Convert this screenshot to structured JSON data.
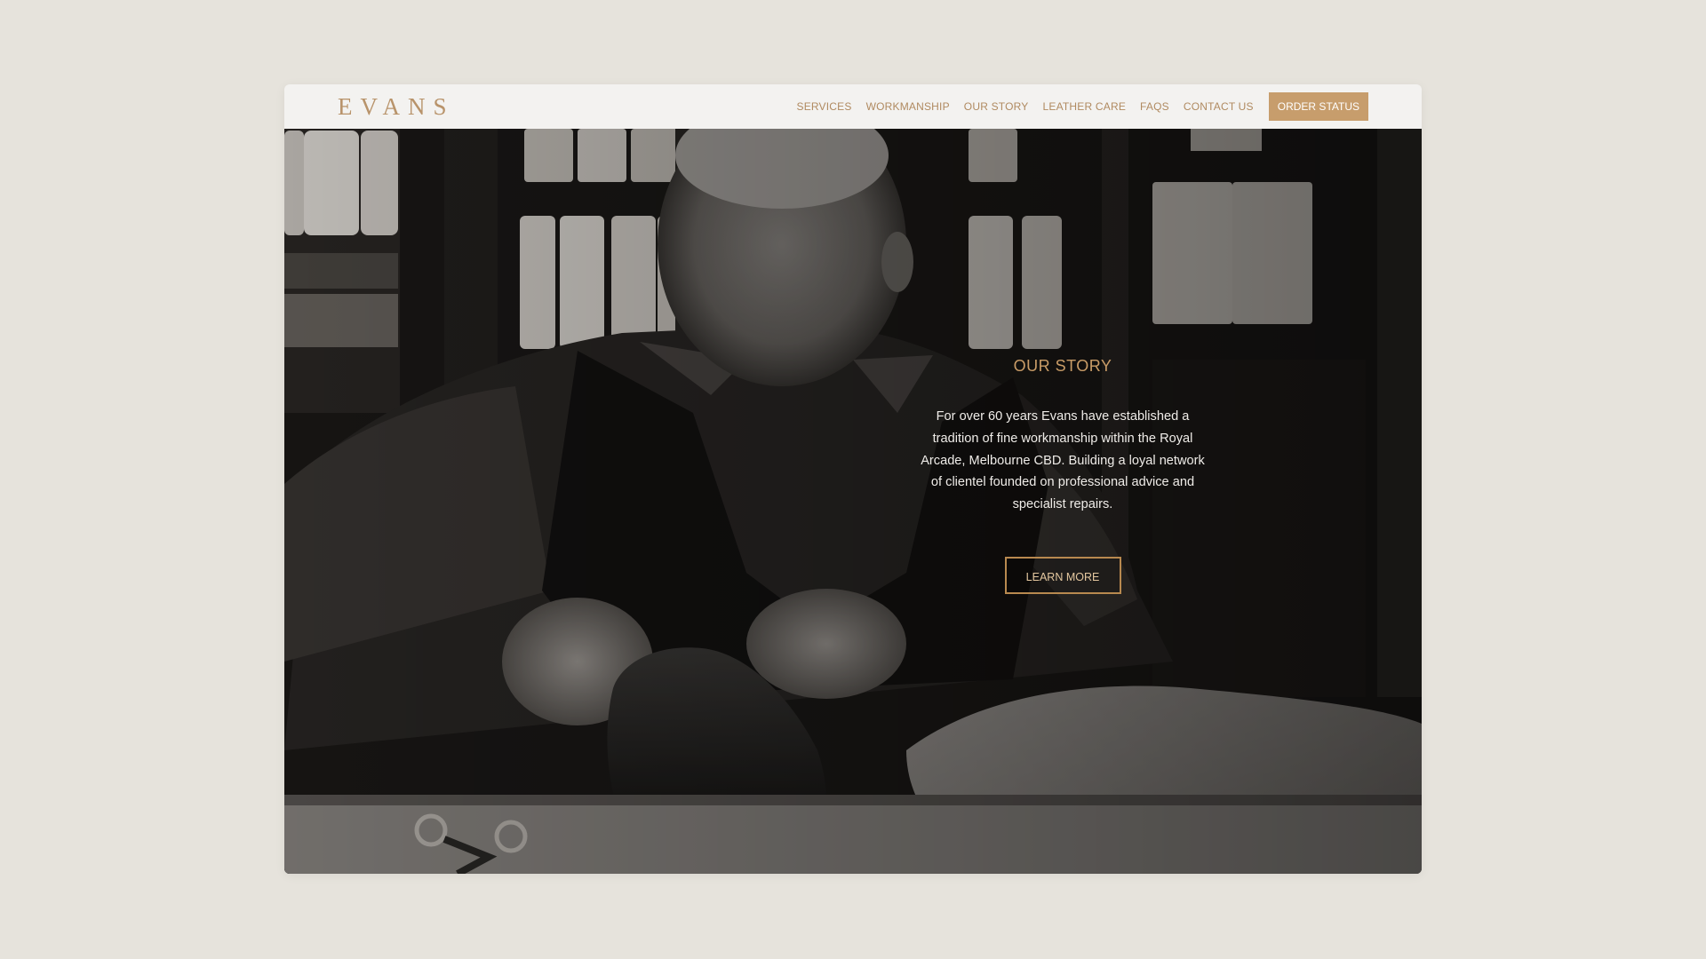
{
  "brand": {
    "logo_text": "EVANS"
  },
  "nav": {
    "items": [
      {
        "label": "SERVICES"
      },
      {
        "label": "WORKMANSHIP"
      },
      {
        "label": "OUR STORY"
      },
      {
        "label": "LEATHER CARE"
      },
      {
        "label": "FAQS"
      },
      {
        "label": "CONTACT US"
      }
    ],
    "order_status_label": "ORDER STATUS"
  },
  "hero": {
    "image_semantic": "cobbler-lacing-shoe-photo",
    "title": "OUR STORY",
    "body": "For over 60 years Evans have established a tradition of fine workmanship within the Royal Arcade, Melbourne CBD. Building a loyal network of clientel founded on professional advice and specialist repairs.",
    "cta_label": "LEARN MORE"
  },
  "colors": {
    "page_background": "#e6e3dc",
    "header_background": "#f3f2f0",
    "accent_gold": "#c79d6c",
    "nav_text": "#b08a60"
  }
}
